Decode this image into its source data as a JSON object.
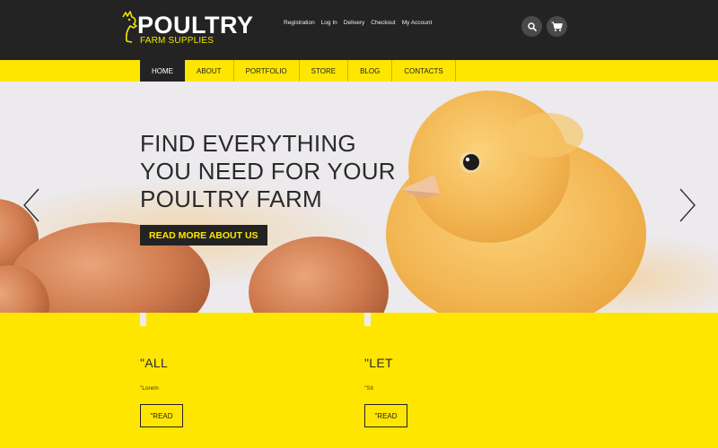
{
  "brand": {
    "title": "POULTRY",
    "subtitle": "FARM SUPPLIES"
  },
  "toplinks": [
    "Registration",
    "Log In",
    "Delivery",
    "Checkout",
    "My Account"
  ],
  "header_icons": {
    "search": "search-icon",
    "cart": "cart-icon"
  },
  "nav": {
    "items": [
      {
        "label": "HOME",
        "active": true
      },
      {
        "label": "ABOUT"
      },
      {
        "label": "PORTFOLIO"
      },
      {
        "label": "STORE"
      },
      {
        "label": "BLOG"
      },
      {
        "label": "CONTACTS"
      }
    ]
  },
  "hero": {
    "lines": [
      "FIND EVERYTHING",
      "YOU NEED FOR YOUR",
      "POULTRY FARM"
    ],
    "button": "READ MORE ABOUT US",
    "prev_icon": "chevron-left-icon",
    "next_icon": "chevron-right-icon"
  },
  "features": [
    {
      "title": "\"ALL",
      "text": "\"Lorem",
      "button": "\"READ"
    },
    {
      "title": "\"LET",
      "text": "\"Sit",
      "button": "\"READ"
    }
  ],
  "colors": {
    "accent": "#ffe600",
    "dark": "#232323",
    "text": "#2a2a2a"
  }
}
